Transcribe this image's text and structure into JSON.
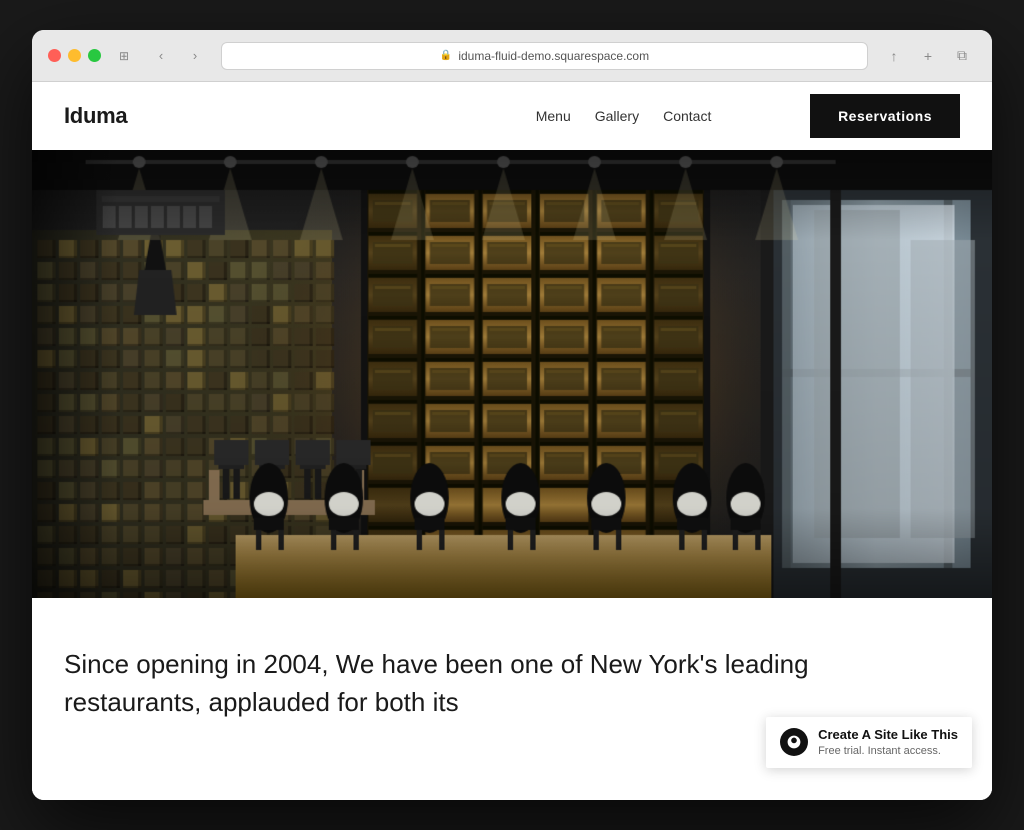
{
  "browser": {
    "url": "iduma-fluid-demo.squarespace.com",
    "back_icon": "‹",
    "forward_icon": "›",
    "refresh_icon": "↻",
    "window_icon": "⊞",
    "share_icon": "↑",
    "add_tab_icon": "+",
    "multi_tab_icon": "⧉"
  },
  "site": {
    "logo": "Iduma",
    "nav": {
      "links": [
        "Menu",
        "Gallery",
        "Contact"
      ],
      "cta": "Reservations"
    },
    "hero": {
      "alt": "Restaurant interior with wine racks and wooden tables"
    },
    "body_text": "Since opening in 2004, We have been one of New York's leading restaurants, applauded for both its",
    "squarespace_badge": {
      "main_text": "Create A Site Like This",
      "sub_text": "Free trial. Instant access.",
      "logo_char": "S"
    }
  }
}
